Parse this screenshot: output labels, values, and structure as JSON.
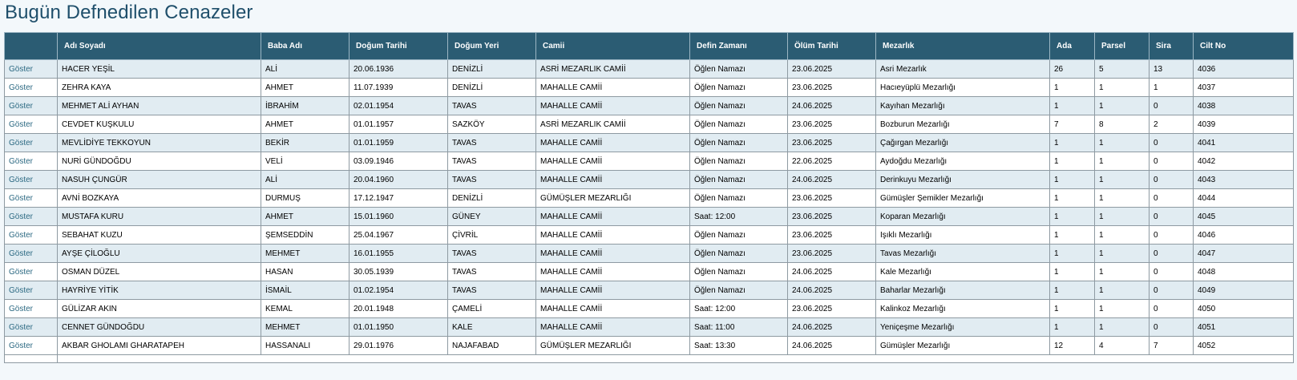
{
  "page": {
    "title": "Bugün Defnedilen Cenazeler"
  },
  "table": {
    "columns": [
      "",
      "Adı Soyadı",
      "Baba Adı",
      "Doğum Tarihi",
      "Doğum Yeri",
      "Camii",
      "Defin Zamanı",
      "Ölüm Tarihi",
      "Mezarlık",
      "Ada",
      "Parsel",
      "Sira",
      "Cilt No"
    ],
    "action_label": "Göster",
    "rows": [
      [
        "HACER YEŞİL",
        "ALİ",
        "20.06.1936",
        "DENİZLİ",
        "ASRİ MEZARLIK CAMİİ",
        "Öğlen Namazı",
        "23.06.2025",
        "Asri Mezarlık",
        "26",
        "5",
        "13",
        "4036"
      ],
      [
        "ZEHRA KAYA",
        "AHMET",
        "11.07.1939",
        "DENİZLİ",
        "MAHALLE CAMİİ",
        "Öğlen Namazı",
        "23.06.2025",
        "Hacıeyüplü Mezarlığı",
        "1",
        "1",
        "1",
        "4037"
      ],
      [
        "MEHMET ALİ AYHAN",
        "İBRAHİM",
        "02.01.1954",
        "TAVAS",
        "MAHALLE CAMİİ",
        "Öğlen Namazı",
        "24.06.2025",
        "Kayıhan Mezarlığı",
        "1",
        "1",
        "0",
        "4038"
      ],
      [
        "CEVDET KUŞKULU",
        "AHMET",
        "01.01.1957",
        "SAZKÖY",
        "ASRİ MEZARLIK CAMİİ",
        "Öğlen Namazı",
        "23.06.2025",
        "Bozburun Mezarlığı",
        "7",
        "8",
        "2",
        "4039"
      ],
      [
        "MEVLİDİYE TEKKOYUN",
        "BEKİR",
        "01.01.1959",
        "TAVAS",
        "MAHALLE CAMİİ",
        "Öğlen Namazı",
        "23.06.2025",
        "Çağırgan Mezarlığı",
        "1",
        "1",
        "0",
        "4041"
      ],
      [
        "NURİ GÜNDOĞDU",
        "VELİ",
        "03.09.1946",
        "TAVAS",
        "MAHALLE CAMİİ",
        "Öğlen Namazı",
        "22.06.2025",
        "Aydoğdu Mezarlığı",
        "1",
        "1",
        "0",
        "4042"
      ],
      [
        "NASUH ÇUNGÜR",
        "ALİ",
        "20.04.1960",
        "TAVAS",
        "MAHALLE CAMİİ",
        "Öğlen Namazı",
        "24.06.2025",
        "Derinkuyu Mezarlığı",
        "1",
        "1",
        "0",
        "4043"
      ],
      [
        "AVNİ BOZKAYA",
        "DURMUŞ",
        "17.12.1947",
        "DENİZLİ",
        "GÜMÜŞLER MEZARLIĞI",
        "Öğlen Namazı",
        "23.06.2025",
        "Gümüşler Şemikler Mezarlığı",
        "1",
        "1",
        "0",
        "4044"
      ],
      [
        "MUSTAFA KURU",
        "AHMET",
        "15.01.1960",
        "GÜNEY",
        "MAHALLE CAMİİ",
        "Saat: 12:00",
        "23.06.2025",
        "Koparan Mezarlığı",
        "1",
        "1",
        "0",
        "4045"
      ],
      [
        "SEBAHAT KUZU",
        "ŞEMSEDDİN",
        "25.04.1967",
        "ÇİVRİL",
        "MAHALLE CAMİİ",
        "Öğlen Namazı",
        "23.06.2025",
        "Işıklı Mezarlığı",
        "1",
        "1",
        "0",
        "4046"
      ],
      [
        "AYŞE ÇİLOĞLU",
        "MEHMET",
        "16.01.1955",
        "TAVAS",
        "MAHALLE CAMİİ",
        "Öğlen Namazı",
        "23.06.2025",
        "Tavas Mezarlığı",
        "1",
        "1",
        "0",
        "4047"
      ],
      [
        "OSMAN DÜZEL",
        "HASAN",
        "30.05.1939",
        "TAVAS",
        "MAHALLE CAMİİ",
        "Öğlen Namazı",
        "24.06.2025",
        "Kale Mezarlığı",
        "1",
        "1",
        "0",
        "4048"
      ],
      [
        "HAYRİYE YİTİK",
        "İSMAİL",
        "01.02.1954",
        "TAVAS",
        "MAHALLE CAMİİ",
        "Öğlen Namazı",
        "24.06.2025",
        "Baharlar Mezarlığı",
        "1",
        "1",
        "0",
        "4049"
      ],
      [
        "GÜLİZAR AKIN",
        "KEMAL",
        "20.01.1948",
        "ÇAMELİ",
        "MAHALLE CAMİİ",
        "Saat: 12:00",
        "23.06.2025",
        "Kalinkoz Mezarlığı",
        "1",
        "1",
        "0",
        "4050"
      ],
      [
        "CENNET GÜNDOĞDU",
        "MEHMET",
        "01.01.1950",
        "KALE",
        "MAHALLE CAMİİ",
        "Saat: 11:00",
        "24.06.2025",
        "Yeniçeşme Mezarlığı",
        "1",
        "1",
        "0",
        "4051"
      ],
      [
        "AKBAR GHOLAMI GHARATAPEH",
        "HASSANALI",
        "29.01.1976",
        "NAJAFABAD",
        "GÜMÜŞLER MEZARLIĞI",
        "Saat: 13:30",
        "24.06.2025",
        "Gümüşler Mezarlığı",
        "12",
        "4",
        "7",
        "4052"
      ]
    ]
  }
}
